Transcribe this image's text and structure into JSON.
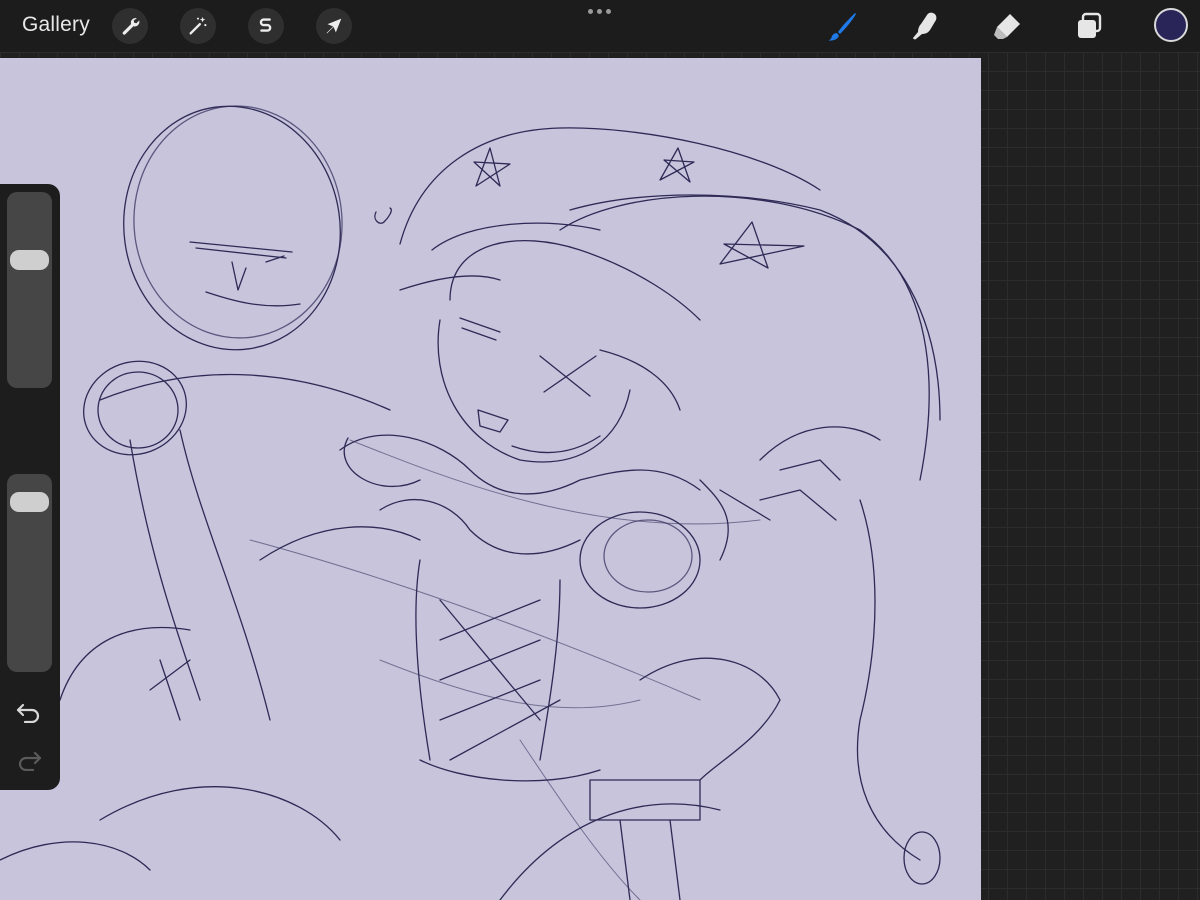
{
  "toolbar": {
    "gallery_label": "Gallery",
    "left_tools": [
      {
        "name": "actions",
        "icon": "wrench-icon"
      },
      {
        "name": "adjustments",
        "icon": "magic-wand-icon"
      },
      {
        "name": "selection",
        "icon": "selection-s-icon"
      },
      {
        "name": "transform",
        "icon": "arrow-cursor-icon"
      }
    ],
    "more_icon": "ellipsis-icon",
    "right_tools": [
      {
        "name": "brush",
        "icon": "brush-icon",
        "active": true
      },
      {
        "name": "smudge",
        "icon": "smudge-finger-icon"
      },
      {
        "name": "eraser",
        "icon": "eraser-icon"
      },
      {
        "name": "layers",
        "icon": "layers-icon"
      }
    ],
    "current_color": "#292558",
    "active_tool_color": "#1f7ae8"
  },
  "canvas": {
    "background_color": "#c7c4dc",
    "stroke_color": "#2f2a55"
  },
  "sidebar": {
    "brush_size_icon": "size-slider",
    "brush_size_level": 0.31,
    "modifier_icon": "square-modifier-icon",
    "opacity_icon": "opacity-slider",
    "opacity_level": 0.06,
    "undo_icon": "undo-arrow-icon",
    "redo_icon": "redo-arrow-icon"
  }
}
